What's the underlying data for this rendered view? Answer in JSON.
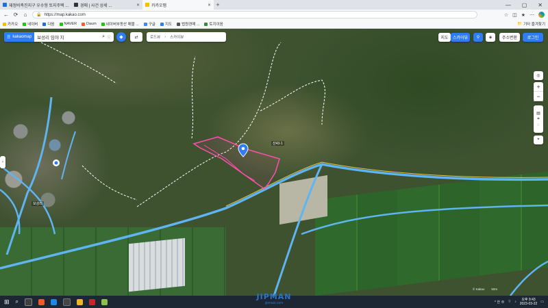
{
  "browser": {
    "tabs": [
      {
        "title": "재정비촉진지구 우수형 토지주택 ...",
        "favicon_color": "#1e6fd9",
        "active": false
      },
      {
        "title": "경매 | 사건 상세 ...",
        "favicon_color": "#333333",
        "active": false
      },
      {
        "title": "카카오맵",
        "favicon_color": "#f2c200",
        "active": true
      }
    ],
    "new_tab_label": "+",
    "window_controls": [
      "—",
      "▢",
      "✕"
    ],
    "url": "https://map.kakao.com",
    "bookmarks": [
      {
        "label": "카카오",
        "color": "#f2c200"
      },
      {
        "label": "네이버",
        "color": "#1ec800"
      },
      {
        "label": "다음",
        "color": "#1e6fd9"
      },
      {
        "label": "NAVER",
        "color": "#1ec800"
      },
      {
        "label": "Daum",
        "color": "#ff5a2d"
      },
      {
        "label": "네이버부동산 매물 ...",
        "color": "#1ec800"
      },
      {
        "label": "구글",
        "color": "#4285f4"
      },
      {
        "label": "지도",
        "color": "#2f7cf6"
      },
      {
        "label": "법원경매 ...",
        "color": "#555555"
      },
      {
        "label": "토지이음",
        "color": "#3b8a3b"
      }
    ],
    "bookmarks_right": "기타 즐겨찾기"
  },
  "map": {
    "brand_label": "kakaomap",
    "search_value": "보성리 임야 지",
    "pin_label": "",
    "roadview": {
      "left": "로드뷰",
      "right": "스카이뷰"
    },
    "top_right": {
      "toggle_a": "지도",
      "toggle_b": "스카이뷰",
      "btn1": "주소변환",
      "btn2": "로그인"
    },
    "zoom": {
      "in": "+",
      "out": "−"
    },
    "labels": [
      {
        "text": "보성리",
        "id": "village"
      },
      {
        "text": "산43-1",
        "id": "parcel"
      }
    ],
    "scale_text": [
      "© Kakao",
      "50m"
    ]
  },
  "taskbar": {
    "tray_text": "^ 한 ⊕",
    "time": "오후 9:43",
    "date": "2023-03-22"
  },
  "watermark": {
    "logo": "JIPMAN",
    "site": "jipmani.com"
  }
}
